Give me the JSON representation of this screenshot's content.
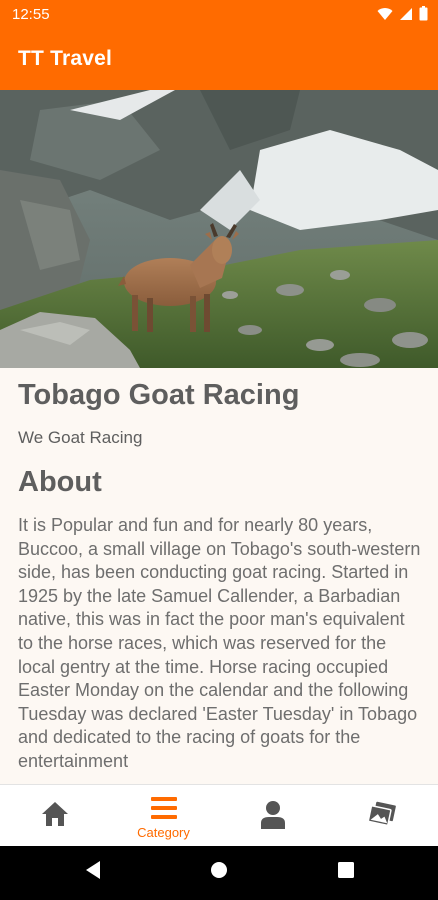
{
  "status_bar": {
    "time": "12:55",
    "icons": [
      "wifi-icon",
      "signal-icon",
      "battery-icon"
    ]
  },
  "app_bar": {
    "title": "TT Travel"
  },
  "hero": {
    "icon": "alpine-ibex-photo"
  },
  "place": {
    "title": "Tobago Goat Racing",
    "subtitle": "We Goat Racing"
  },
  "about": {
    "heading": "About",
    "text": "It is Popular and fun and for nearly 80 years, Buccoo, a small village on Tobago's south-western side, has been conducting goat racing. Started in 1925 by the late Samuel Callender, a Barbadian native, this was in fact the poor man's equivalent to the horse races, which was reserved for the local gentry at the time. Horse racing occupied Easter Monday on the calendar and the following Tuesday was declared 'Easter Tuesday' in Tobago and dedicated to the racing of goats for the entertainment"
  },
  "bottom_nav": {
    "items": [
      {
        "icon": "home-icon",
        "label": "",
        "active": false
      },
      {
        "icon": "menu-icon",
        "label": "Category",
        "active": true
      },
      {
        "icon": "person-icon",
        "label": "",
        "active": false
      },
      {
        "icon": "photos-icon",
        "label": "",
        "active": false
      }
    ]
  },
  "colors": {
    "brand": "#FF6B00",
    "background": "#FDF8F3",
    "text": "#5E5E5E",
    "nav_inactive": "#555555"
  },
  "system_nav": {
    "icons": [
      "back-icon",
      "home-circle-icon",
      "recents-icon"
    ]
  }
}
